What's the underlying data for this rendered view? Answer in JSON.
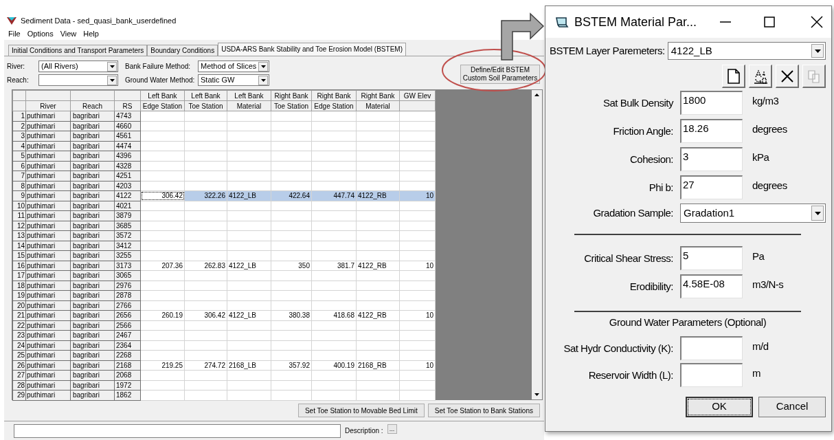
{
  "window": {
    "title": "Sediment Data - sed_quasi_bank_userdefined"
  },
  "menu": [
    "File",
    "Options",
    "View",
    "Help"
  ],
  "tabs": [
    {
      "label": "Initial Conditions and Transport Parameters",
      "selected": false
    },
    {
      "label": "Boundary Conditions",
      "selected": false
    },
    {
      "label": "USDA-ARS Bank Stability and Toe Erosion Model (BSTEM)",
      "selected": true
    }
  ],
  "filters": {
    "river": {
      "label": "River:",
      "value": "(All Rivers)"
    },
    "reach": {
      "label": "Reach:"
    },
    "bank_failure_method": {
      "label": "Bank Failure Method:",
      "value": "Method of Slices"
    },
    "ground_water_method": {
      "label": "Ground Water Method:",
      "value": "Static GW"
    }
  },
  "define_button": "Define/Edit BSTEM Custom Soil Parameters",
  "table": {
    "columns": [
      {
        "line2": "River"
      },
      {
        "line2": "Reach"
      },
      {
        "line2": "RS"
      },
      {
        "line1": "Left Bank",
        "line2": "Edge Station",
        "kind": "number"
      },
      {
        "line1": "Left Bank",
        "line2": "Toe Station",
        "kind": "number"
      },
      {
        "line1": "Left Bank",
        "line2": "Material",
        "kind": "text"
      },
      {
        "line1": "Right Bank",
        "line2": "Toe Station",
        "kind": "number"
      },
      {
        "line1": "Right Bank",
        "line2": "Edge Station",
        "kind": "number"
      },
      {
        "line1": "Right Bank",
        "line2": "Material",
        "kind": "text"
      },
      {
        "line1": "GW Elev",
        "kind": "number"
      }
    ],
    "rows": [
      {
        "n": "1",
        "river": "puthimari",
        "reach": "bagribari",
        "rs": "4743",
        "selected": false
      },
      {
        "n": "2",
        "river": "puthimari",
        "reach": "bagribari",
        "rs": "4660",
        "selected": false
      },
      {
        "n": "3",
        "river": "puthimari",
        "reach": "bagribari",
        "rs": "4561",
        "selected": false
      },
      {
        "n": "4",
        "river": "puthimari",
        "reach": "bagribari",
        "rs": "4474",
        "selected": false
      },
      {
        "n": "5",
        "river": "puthimari",
        "reach": "bagribari",
        "rs": "4396",
        "selected": false
      },
      {
        "n": "6",
        "river": "puthimari",
        "reach": "bagribari",
        "rs": "4328",
        "selected": false
      },
      {
        "n": "7",
        "river": "puthimari",
        "reach": "bagribari",
        "rs": "4251",
        "selected": false
      },
      {
        "n": "8",
        "river": "puthimari",
        "reach": "bagribari",
        "rs": "4203",
        "selected": false
      },
      {
        "n": "9",
        "river": "puthimari",
        "reach": "bagribari",
        "rs": "4122",
        "selected": true,
        "values": [
          "306.42",
          "322.26",
          "4122_LB",
          "422.64",
          "447.74",
          "4122_RB",
          "10"
        ]
      },
      {
        "n": "10",
        "river": "puthimari",
        "reach": "bagribari",
        "rs": "4021",
        "selected": false
      },
      {
        "n": "11",
        "river": "puthimari",
        "reach": "bagribari",
        "rs": "3879",
        "selected": false
      },
      {
        "n": "12",
        "river": "puthimari",
        "reach": "bagribari",
        "rs": "3685",
        "selected": false
      },
      {
        "n": "13",
        "river": "puthimari",
        "reach": "bagribari",
        "rs": "3572",
        "selected": false
      },
      {
        "n": "14",
        "river": "puthimari",
        "reach": "bagribari",
        "rs": "3412",
        "selected": false
      },
      {
        "n": "15",
        "river": "puthimari",
        "reach": "bagribari",
        "rs": "3255",
        "selected": false
      },
      {
        "n": "16",
        "river": "puthimari",
        "reach": "bagribari",
        "rs": "3173",
        "selected": false,
        "values": [
          "207.36",
          "262.83",
          "4122_LB",
          "350",
          "381.7",
          "4122_RB",
          "10"
        ]
      },
      {
        "n": "17",
        "river": "puthimari",
        "reach": "bagribari",
        "rs": "3065",
        "selected": false
      },
      {
        "n": "18",
        "river": "puthimari",
        "reach": "bagribari",
        "rs": "2976",
        "selected": false
      },
      {
        "n": "19",
        "river": "puthimari",
        "reach": "bagribari",
        "rs": "2878",
        "selected": false
      },
      {
        "n": "20",
        "river": "puthimari",
        "reach": "bagribari",
        "rs": "2766",
        "selected": false
      },
      {
        "n": "21",
        "river": "puthimari",
        "reach": "bagribari",
        "rs": "2656",
        "selected": false,
        "values": [
          "260.19",
          "306.42",
          "4122_LB",
          "380.38",
          "418.68",
          "4122_RB",
          "10"
        ]
      },
      {
        "n": "22",
        "river": "puthimari",
        "reach": "bagribari",
        "rs": "2566",
        "selected": false
      },
      {
        "n": "23",
        "river": "puthimari",
        "reach": "bagribari",
        "rs": "2467",
        "selected": false
      },
      {
        "n": "24",
        "river": "puthimari",
        "reach": "bagribari",
        "rs": "2364",
        "selected": false
      },
      {
        "n": "25",
        "river": "puthimari",
        "reach": "bagribari",
        "rs": "2268",
        "selected": false
      },
      {
        "n": "26",
        "river": "puthimari",
        "reach": "bagribari",
        "rs": "2168",
        "selected": false,
        "values": [
          "219.25",
          "274.72",
          "2168_LB",
          "357.92",
          "400.19",
          "2168_RB",
          "10"
        ]
      },
      {
        "n": "27",
        "river": "puthimari",
        "reach": "bagribari",
        "rs": "2068",
        "selected": false
      },
      {
        "n": "28",
        "river": "puthimari",
        "reach": "bagribari",
        "rs": "1972",
        "selected": false
      },
      {
        "n": "29",
        "river": "puthimari",
        "reach": "bagribari",
        "rs": "1862",
        "selected": false
      }
    ]
  },
  "bottom_buttons": [
    "Set Toe Station to Movable Bed Limit",
    "Set Toe Station to Bank Stations"
  ],
  "description": {
    "label": "Description :",
    "button": "..."
  },
  "dialog": {
    "title": "BSTEM Material Par...",
    "layer": {
      "label": "BSTEM Layer Paremeters:",
      "value": "4122_LB"
    },
    "toolbar": [
      {
        "kind": "new",
        "disabled": false
      },
      {
        "kind": "rename",
        "disabled": false
      },
      {
        "kind": "delete",
        "disabled": false
      },
      {
        "kind": "copy",
        "disabled": true
      }
    ],
    "fields": [
      {
        "label": "Sat Bulk Density",
        "value": "1800",
        "unit": "kg/m3"
      },
      {
        "label": "Friction Angle:",
        "value": "18.26",
        "unit": "degrees"
      },
      {
        "label": "Cohesion:",
        "value": "3",
        "unit": "kPa"
      },
      {
        "label": "Phi b:",
        "value": "27",
        "unit": "degrees"
      }
    ],
    "gradation": {
      "label": "Gradation Sample:",
      "value": "Gradation1"
    },
    "erosion_fields": [
      {
        "label": "Critical Shear Stress:",
        "value": "5",
        "unit": "Pa"
      },
      {
        "label": "Erodibility:",
        "value": "4.58E-08",
        "unit": "m3/N-s"
      }
    ],
    "gw_heading": "Ground Water Parameters (Optional)",
    "gw_fields": [
      {
        "label": "Sat Hydr Conductivity (K):",
        "unit": "m/d"
      },
      {
        "label": "Reservoir Width (L):",
        "unit": "m"
      }
    ],
    "buttons": [
      "OK",
      "Cancel"
    ]
  }
}
